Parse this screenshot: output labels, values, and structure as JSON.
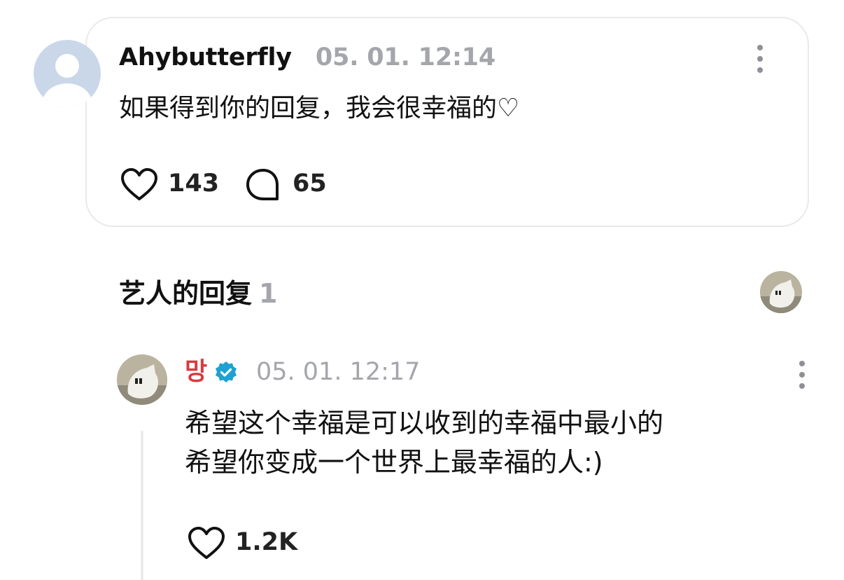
{
  "comment": {
    "username": "Ahybutterfly",
    "timestamp": "05. 01. 12:14",
    "text": "如果得到你的回复，我会很幸福的♡",
    "likes": "143",
    "replies": "65"
  },
  "artist_section": {
    "title": "艺人的回复",
    "count": "1"
  },
  "artist_reply": {
    "name": "망",
    "verified": true,
    "timestamp": "05. 01. 12:17",
    "lines": [
      "希望这个幸福是可以收到的幸福中最小的",
      "希望你变成一个世界上最幸福的人:)"
    ],
    "likes": "1.2K"
  },
  "colors": {
    "artist_name": "#d83a3f",
    "verified_badge": "#1da1d2",
    "muted_text": "#a4a6ab"
  },
  "icons": [
    "user-avatar-placeholder",
    "more-vertical-icon",
    "heart-icon",
    "comment-bubble-icon",
    "verified-badge-icon"
  ]
}
